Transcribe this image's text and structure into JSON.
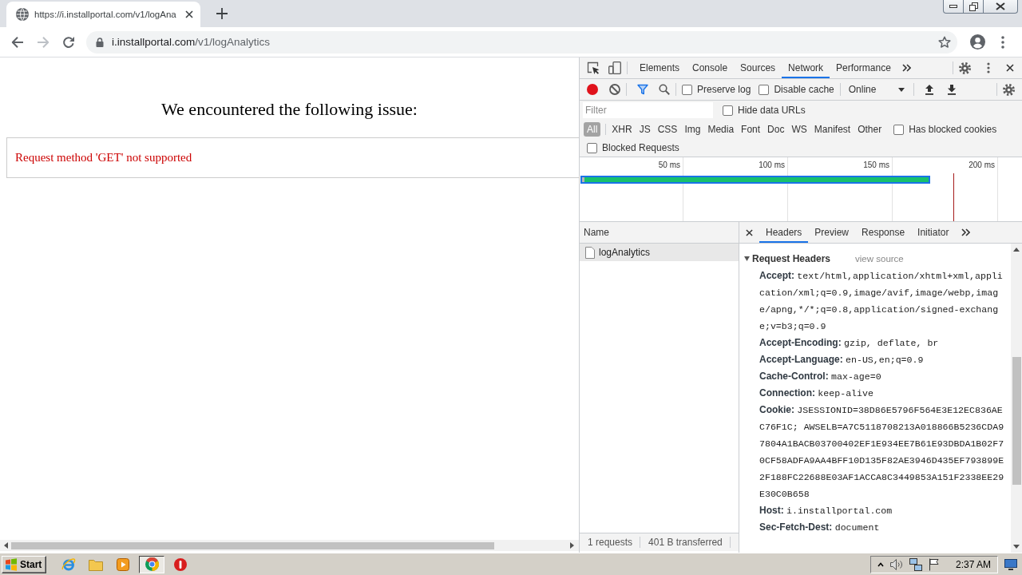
{
  "browser_tabs": [
    {
      "title": "https://i.installportal.com/v1/logAna",
      "selected": true
    }
  ],
  "nav_buttons": [
    {
      "kind": "back",
      "disabled": false
    },
    {
      "kind": "forward",
      "disabled": true
    },
    {
      "kind": "reload",
      "disabled": false
    }
  ],
  "address_bar": {
    "secure": true,
    "host": "i.installportal.com",
    "path": "/v1/logAnalytics"
  },
  "page": {
    "heading": "We encountered the following issue:",
    "error_message": "Request method 'GET' not supported"
  },
  "devtools": {
    "panel_tabs": [
      {
        "label": "Elements",
        "selected": false
      },
      {
        "label": "Console",
        "selected": false
      },
      {
        "label": "Sources",
        "selected": false
      },
      {
        "label": "Network",
        "selected": true
      },
      {
        "label": "Performance",
        "selected": false
      }
    ],
    "network_toolbar": {
      "recording": true,
      "preserve_log": {
        "label": "Preserve log",
        "checked": false
      },
      "disable_cache": {
        "label": "Disable cache",
        "checked": false
      },
      "throttling": "Online"
    },
    "filter_bar": {
      "placeholder": "Filter",
      "hide_data_urls": {
        "label": "Hide data URLs",
        "checked": false
      }
    },
    "type_filters": [
      {
        "label": "All",
        "selected": true
      },
      {
        "label": "XHR",
        "selected": false
      },
      {
        "label": "JS",
        "selected": false
      },
      {
        "label": "CSS",
        "selected": false
      },
      {
        "label": "Img",
        "selected": false
      },
      {
        "label": "Media",
        "selected": false
      },
      {
        "label": "Font",
        "selected": false
      },
      {
        "label": "Doc",
        "selected": false
      },
      {
        "label": "WS",
        "selected": false
      },
      {
        "label": "Manifest",
        "selected": false
      },
      {
        "label": "Other",
        "selected": false
      }
    ],
    "has_blocked_cookies": {
      "label": "Has blocked cookies",
      "checked": false
    },
    "blocked_requests": {
      "label": "Blocked Requests",
      "checked": false
    },
    "timeline": {
      "ticks": [
        "50 ms",
        "100 ms",
        "150 ms",
        "200 ms"
      ]
    },
    "request_list": {
      "column": "Name",
      "rows": [
        {
          "name": "logAnalytics",
          "selected": true
        }
      ]
    },
    "status_bar": [
      "1 requests",
      "401 B transferred"
    ],
    "detail_tabs": [
      {
        "label": "Headers",
        "selected": true
      },
      {
        "label": "Preview",
        "selected": false
      },
      {
        "label": "Response",
        "selected": false
      },
      {
        "label": "Initiator",
        "selected": false
      }
    ],
    "request_headers": {
      "title": "Request Headers",
      "expanded": true,
      "view_source": "view source",
      "headers": [
        {
          "name": "Accept:",
          "value": "text/html,application/xhtml+xml,application/xml;q=0.9,image/avif,image/webp,image/apng,*/*;q=0.8,application/signed-exchange;v=b3;q=0.9"
        },
        {
          "name": "Accept-Encoding:",
          "value": "gzip, deflate, br"
        },
        {
          "name": "Accept-Language:",
          "value": "en-US,en;q=0.9"
        },
        {
          "name": "Cache-Control:",
          "value": "max-age=0"
        },
        {
          "name": "Connection:",
          "value": "keep-alive"
        },
        {
          "name": "Cookie:",
          "value": "JSESSIONID=38D86E5796F564E3E12EC836AEC76F1C; AWSELB=A7C5118708213A018866B5236CDA97804A1BACB03700402EF1E934EE7B61E93DBDA1B02F70CF58ADFA9AA4BFF10D135F82AE3946D435EF793899E2F188FC22688E03AF1ACCA8C3449853A151F2338EE29E30C0B658"
        },
        {
          "name": "Host:",
          "value": "i.installportal.com"
        },
        {
          "name": "Sec-Fetch-Dest:",
          "value": "document"
        }
      ]
    }
  },
  "taskbar": {
    "start": "Start",
    "apps": [
      {
        "kind": "ie",
        "selected": false
      },
      {
        "kind": "folder",
        "selected": false
      },
      {
        "kind": "media",
        "selected": false
      },
      {
        "kind": "chrome",
        "selected": true
      },
      {
        "kind": "stop",
        "selected": false
      }
    ],
    "clock": "2:37 AM"
  }
}
